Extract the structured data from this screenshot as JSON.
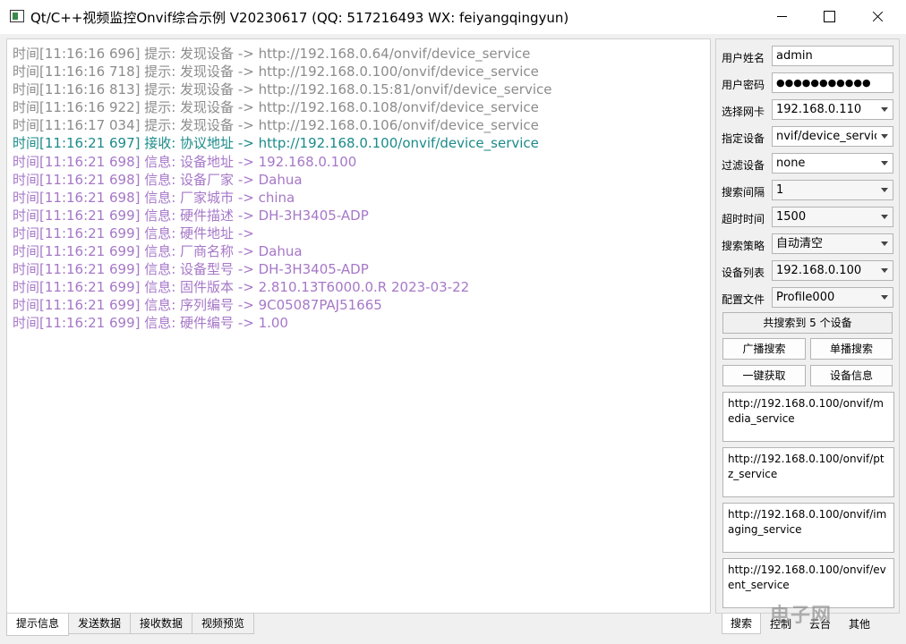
{
  "window": {
    "title": "Qt/C++视频监控Onvif综合示例 V20230617 (QQ: 517216493 WX: feiyangqingyun)",
    "app_icon": "app-window-icon",
    "controls": {
      "minimize": "minimize-icon",
      "maximize": "maximize-icon",
      "close": "close-icon"
    }
  },
  "log": {
    "lines": [
      {
        "text": "时间[11:16:16 696] 提示: 发现设备 -> http://192.168.0.64/onvif/device_service",
        "color": "#8c8c8c"
      },
      {
        "text": "时间[11:16:16 718] 提示: 发现设备 -> http://192.168.0.100/onvif/device_service",
        "color": "#8c8c8c"
      },
      {
        "text": "时间[11:16:16 813] 提示: 发现设备 -> http://192.168.0.15:81/onvif/device_service",
        "color": "#8c8c8c"
      },
      {
        "text": "时间[11:16:16 922] 提示: 发现设备 -> http://192.168.0.108/onvif/device_service",
        "color": "#8c8c8c"
      },
      {
        "text": "时间[11:16:17 034] 提示: 发现设备 -> http://192.168.0.106/onvif/device_service",
        "color": "#8c8c8c"
      },
      {
        "text": "时间[11:16:21 697] 接收: 协议地址 -> http://192.168.0.100/onvif/device_service",
        "color": "#1c8a8a"
      },
      {
        "text": "时间[11:16:21 698] 信息: 设备地址 -> 192.168.0.100",
        "color": "#a678c8"
      },
      {
        "text": "时间[11:16:21 698] 信息: 设备厂家 -> Dahua",
        "color": "#a678c8"
      },
      {
        "text": "时间[11:16:21 698] 信息: 厂家城市 -> china",
        "color": "#a678c8"
      },
      {
        "text": "时间[11:16:21 699] 信息: 硬件描述 -> DH-3H3405-ADP",
        "color": "#a678c8"
      },
      {
        "text": "时间[11:16:21 699] 信息: 硬件地址 ->",
        "color": "#a678c8"
      },
      {
        "text": "时间[11:16:21 699] 信息: 厂商名称 -> Dahua",
        "color": "#a678c8"
      },
      {
        "text": "时间[11:16:21 699] 信息: 设备型号 -> DH-3H3405-ADP",
        "color": "#a678c8"
      },
      {
        "text": "时间[11:16:21 699] 信息: 固件版本 -> 2.810.13T6000.0.R 2023-03-22",
        "color": "#a678c8"
      },
      {
        "text": "时间[11:16:21 699] 信息: 序列编号 -> 9C05087PAJ51665",
        "color": "#a678c8"
      },
      {
        "text": "时间[11:16:21 699] 信息: 硬件编号 -> 1.00",
        "color": "#a678c8"
      }
    ]
  },
  "bottom_tabs": [
    "提示信息",
    "发送数据",
    "接收数据",
    "视频预览"
  ],
  "form": {
    "username_label": "用户姓名",
    "username_value": "admin",
    "password_label": "用户密码",
    "password_value": "●●●●●●●●●●●",
    "nic_label": "选择网卡",
    "nic_value": "192.168.0.110",
    "device_label": "指定设备",
    "device_value": "nvif/device_service",
    "filter_label": "过滤设备",
    "filter_value": "none",
    "interval_label": "搜索间隔",
    "interval_value": "1",
    "timeout_label": "超时时间",
    "timeout_value": "1500",
    "strategy_label": "搜索策略",
    "strategy_value": "自动清空",
    "devlist_label": "设备列表",
    "devlist_value": "192.168.0.100",
    "profile_label": "配置文件",
    "profile_value": "Profile000"
  },
  "buttons": {
    "found_count": "共搜索到 5 个设备",
    "broadcast_search": "广播搜索",
    "single_search": "单播搜索",
    "one_click_get": "一键获取",
    "device_info": "设备信息"
  },
  "service_urls": [
    "http://192.168.0.100/onvif/media_service",
    "http://192.168.0.100/onvif/ptz_service",
    "http://192.168.0.100/onvif/imaging_service",
    "http://192.168.0.100/onvif/event_service"
  ],
  "right_tabs": [
    "搜索",
    "控制",
    "云台",
    "其他"
  ],
  "watermark": "电子网"
}
